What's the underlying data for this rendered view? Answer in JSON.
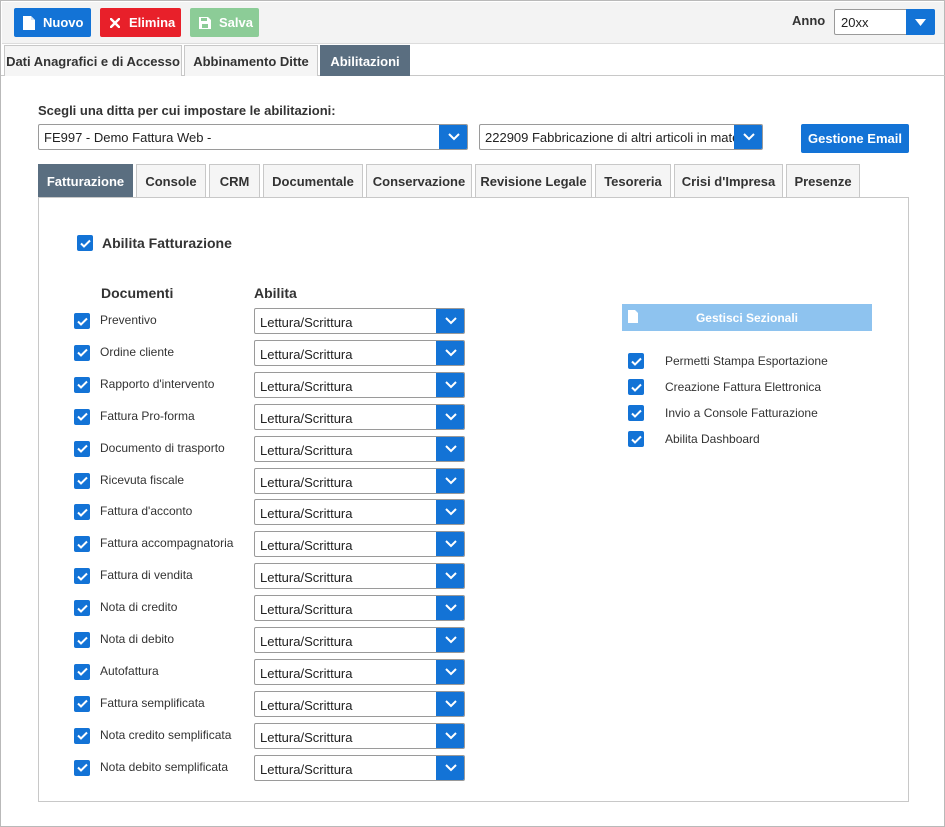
{
  "toolbar": {
    "nuovo_label": "Nuovo",
    "elimina_label": "Elimina",
    "salva_label": "Salva",
    "anno_label": "Anno",
    "anno_value": "20xx"
  },
  "top_tabs": [
    {
      "label": "Dati Anagrafici e di Accesso",
      "active": false
    },
    {
      "label": "Abbinamento Ditte",
      "active": false
    },
    {
      "label": "Abilitazioni",
      "active": true
    }
  ],
  "ditta": {
    "label": "Scegli una ditta per cui impostare le abilitazioni:",
    "selected": "FE997 - Demo Fattura Web -",
    "ateco": "222909 Fabbricazione di altri articoli in mate",
    "email_button": "Gestione Email"
  },
  "inner_tabs": [
    {
      "label": "Fatturazione",
      "active": true
    },
    {
      "label": "Console",
      "active": false
    },
    {
      "label": "CRM",
      "active": false
    },
    {
      "label": "Documentale",
      "active": false
    },
    {
      "label": "Conservazione",
      "active": false
    },
    {
      "label": "Revisione Legale",
      "active": false
    },
    {
      "label": "Tesoreria",
      "active": false
    },
    {
      "label": "Crisi d'Impresa",
      "active": false
    },
    {
      "label": "Presenze",
      "active": false
    }
  ],
  "fatturazione": {
    "abilita_label": "Abilita Fatturazione",
    "abilita_checked": true,
    "col_documenti": "Documenti",
    "col_abilita": "Abilita",
    "documents": [
      {
        "label": "Preventivo",
        "checked": true,
        "permission": "Lettura/Scrittura"
      },
      {
        "label": "Ordine cliente",
        "checked": true,
        "permission": "Lettura/Scrittura"
      },
      {
        "label": "Rapporto d'intervento",
        "checked": true,
        "permission": "Lettura/Scrittura"
      },
      {
        "label": "Fattura Pro-forma",
        "checked": true,
        "permission": "Lettura/Scrittura"
      },
      {
        "label": "Documento di trasporto",
        "checked": true,
        "permission": "Lettura/Scrittura"
      },
      {
        "label": "Ricevuta fiscale",
        "checked": true,
        "permission": "Lettura/Scrittura"
      },
      {
        "label": "Fattura d'acconto",
        "checked": true,
        "permission": "Lettura/Scrittura"
      },
      {
        "label": "Fattura accompagnatoria",
        "checked": true,
        "permission": "Lettura/Scrittura"
      },
      {
        "label": "Fattura di vendita",
        "checked": true,
        "permission": "Lettura/Scrittura"
      },
      {
        "label": "Nota di credito",
        "checked": true,
        "permission": "Lettura/Scrittura"
      },
      {
        "label": "Nota di debito",
        "checked": true,
        "permission": "Lettura/Scrittura"
      },
      {
        "label": "Autofattura",
        "checked": true,
        "permission": "Lettura/Scrittura"
      },
      {
        "label": "Fattura semplificata",
        "checked": true,
        "permission": "Lettura/Scrittura"
      },
      {
        "label": "Nota credito semplificata",
        "checked": true,
        "permission": "Lettura/Scrittura"
      },
      {
        "label": "Nota debito semplificata",
        "checked": true,
        "permission": "Lettura/Scrittura"
      }
    ],
    "sezionali_button": "Gestisci Sezionali",
    "options": [
      {
        "label": "Permetti Stampa Esportazione",
        "checked": true
      },
      {
        "label": "Creazione Fattura Elettronica",
        "checked": true
      },
      {
        "label": "Invio a Console Fatturazione",
        "checked": true
      },
      {
        "label": "Abilita Dashboard",
        "checked": true
      }
    ]
  },
  "colors": {
    "primary": "#1373d6",
    "danger": "#e8202a",
    "success_disabled": "#8ccc97",
    "tab_active": "#5a6e80",
    "button_disabled": "#8ec3ef"
  },
  "icons": {
    "nuovo": "document-icon",
    "elimina": "close-icon",
    "salva": "floppy-disk-icon",
    "dropdown": "chevron-down-icon",
    "checkbox": "checkmark-icon",
    "sezionali": "document-icon"
  }
}
